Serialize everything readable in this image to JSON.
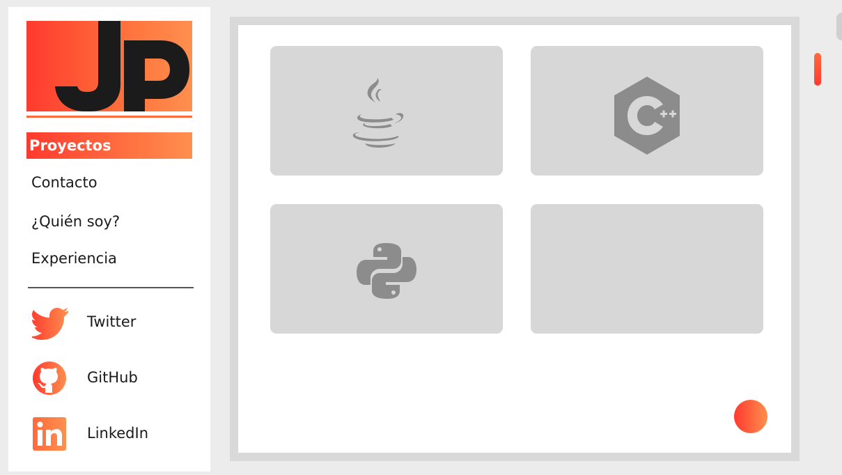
{
  "brand": {
    "logo_text": "JP"
  },
  "nav": {
    "active": "Proyectos",
    "items": [
      "Contacto",
      "¿Quién soy?",
      "Experiencia"
    ]
  },
  "social": [
    {
      "label": "Twitter",
      "icon": "twitter-icon"
    },
    {
      "label": "GitHub",
      "icon": "github-icon"
    },
    {
      "label": "LinkedIn",
      "icon": "linkedin-icon"
    }
  ],
  "projects": [
    {
      "icon": "java-icon"
    },
    {
      "icon": "cplusplus-icon"
    },
    {
      "icon": "python-icon"
    },
    {
      "icon": ""
    }
  ],
  "colors": {
    "accent_start": "#ff3a2f",
    "accent_end": "#ff8f4e",
    "card": "#d7d7d7",
    "icon_gray": "#8c8c8c",
    "logo_dark": "#1b1b1b"
  }
}
